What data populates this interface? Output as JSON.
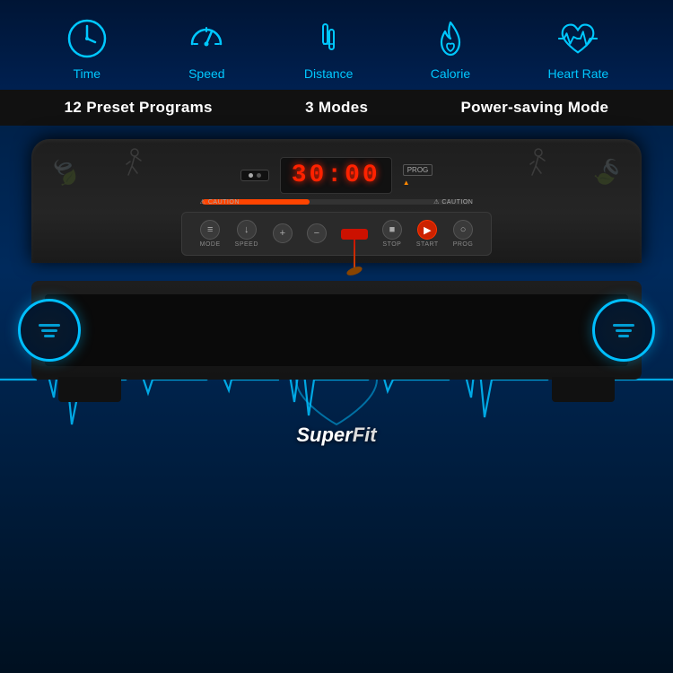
{
  "header": {
    "icons": [
      {
        "id": "time",
        "label": "Time",
        "icon": "clock"
      },
      {
        "id": "speed",
        "label": "Speed",
        "icon": "speedometer"
      },
      {
        "id": "distance",
        "label": "Distance",
        "icon": "distance"
      },
      {
        "id": "calorie",
        "label": "Calorie",
        "icon": "flame"
      },
      {
        "id": "heartrate",
        "label": "Heart Rate",
        "icon": "heartrate"
      }
    ]
  },
  "features": [
    {
      "label": "12 Preset Programs"
    },
    {
      "label": "3 Modes"
    },
    {
      "label": "Power-saving Mode"
    }
  ],
  "console": {
    "display": "30:00",
    "controls": [
      {
        "label": "MODE",
        "symbol": "≡"
      },
      {
        "label": "SPEED",
        "symbol": "↓"
      },
      {
        "label": "+",
        "symbol": "+"
      },
      {
        "label": "−",
        "symbol": "−"
      },
      {
        "label": "STOP",
        "symbol": "■"
      },
      {
        "label": "START",
        "symbol": "▶"
      },
      {
        "label": "PROG",
        "symbol": "○"
      }
    ]
  },
  "brand": {
    "name": "SuperFit",
    "accent": "Super"
  },
  "colors": {
    "cyan": "#00c8ff",
    "red": "#ff2200",
    "bg_dark": "#001020",
    "bg_mid": "#002050"
  }
}
